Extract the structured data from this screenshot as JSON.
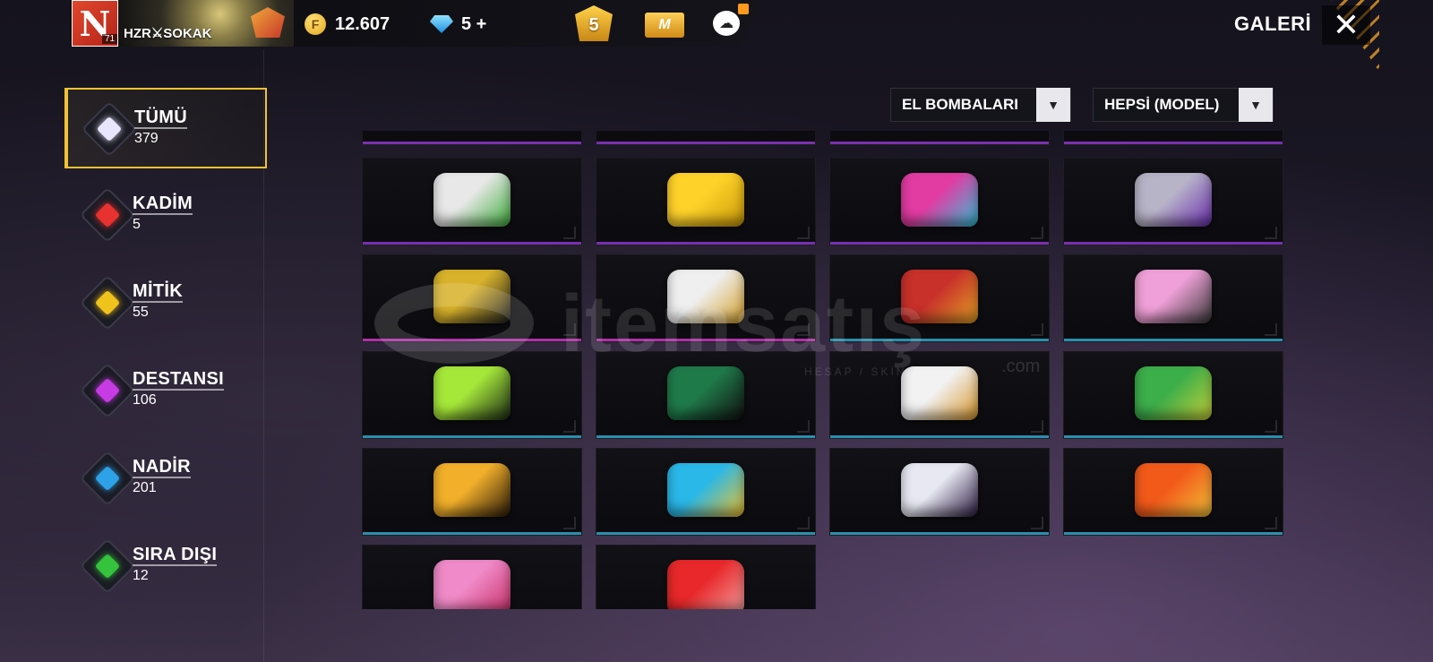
{
  "header": {
    "player_name": "HZR⚔SOKAK",
    "player_level": "71",
    "avatar_letter": "N",
    "coins": "12.607",
    "diamonds": "5 +",
    "pass_level": "5",
    "membership_label": "M",
    "title": "GALERİ"
  },
  "sidebar": {
    "items": [
      {
        "label": "TÜMÜ",
        "count": "379",
        "color": "#e8e6ff"
      },
      {
        "label": "KADİM",
        "count": "5",
        "color": "#e8322f"
      },
      {
        "label": "MİTİK",
        "count": "55",
        "color": "#f0c21c"
      },
      {
        "label": "DESTANSI",
        "count": "106",
        "color": "#c63be4"
      },
      {
        "label": "NADİR",
        "count": "201",
        "color": "#2ea2e8"
      },
      {
        "label": "SIRA DIŞI",
        "count": "12",
        "color": "#35c23c"
      }
    ]
  },
  "filters": {
    "type": "EL BOMBALARI",
    "model": "HEPSİ (MODEL)"
  },
  "watermark": {
    "brand": "itemsatış",
    "tagline": "HESAP / SKİN / ... PİN",
    "domain": ".com"
  },
  "grid_rows": [
    {
      "rarity": "epic",
      "colors": [
        "#7a2fb0",
        "#7a2fb0",
        "#7a2fb0",
        "#7a2fb0"
      ],
      "items": [
        {
          "name": "cat-grenade",
          "c1": "#e8e8e8",
          "c2": "#3fae3c"
        },
        {
          "name": "gold-crystal-grenade",
          "c1": "#ffd22a",
          "c2": "#c99a08"
        },
        {
          "name": "pink-cyan-royal-grenade",
          "c1": "#e23ca3",
          "c2": "#2fc3d8"
        },
        {
          "name": "violet-mecha-grenade",
          "c1": "#b8b4c8",
          "c2": "#6b2fb0"
        }
      ]
    },
    {
      "rarity": "mixed",
      "colors": [
        "#b02fa8",
        "#b02fa8",
        "#2a8fae",
        "#2a8fae"
      ],
      "items": [
        {
          "name": "gold-circuit-grenade",
          "c1": "#d8b22a",
          "c2": "#222"
        },
        {
          "name": "white-gold-wing-grenade",
          "c1": "#efefef",
          "c2": "#d6a12a"
        },
        {
          "name": "red-gold-flame-grenade",
          "c1": "#c8302a",
          "c2": "#e3a326"
        },
        {
          "name": "anime-girl-grenade",
          "c1": "#f0a0d8",
          "c2": "#3a3a3a"
        }
      ]
    },
    {
      "rarity": "rare",
      "colors": [
        "#2a8fae",
        "#2a8fae",
        "#2a8fae",
        "#2a8fae"
      ],
      "items": [
        {
          "name": "neon-green-grenade",
          "c1": "#a6e83a",
          "c2": "#1c2a14"
        },
        {
          "name": "demon-slayer-grenade",
          "c1": "#1f7a4a",
          "c2": "#111"
        },
        {
          "name": "white-phoenix-grenade",
          "c1": "#f2f2f2",
          "c2": "#d8962a"
        },
        {
          "name": "green-dragon-grenade",
          "c1": "#3cae4a",
          "c2": "#c8d23a"
        }
      ]
    },
    {
      "rarity": "rare",
      "colors": [
        "#2a8fae",
        "#2a8fae",
        "#2a8fae",
        "#2a8fae"
      ],
      "items": [
        {
          "name": "pumpkin-grenade",
          "c1": "#f2b02a",
          "c2": "#2a1a0a"
        },
        {
          "name": "truck-grenade",
          "c1": "#2ab8e8",
          "c2": "#f2c22a"
        },
        {
          "name": "dark-white-claw-grenade",
          "c1": "#e8e8f2",
          "c2": "#2a1a40"
        },
        {
          "name": "fire-pig-grenade",
          "c1": "#f25a1a",
          "c2": "#f2c23a"
        }
      ]
    },
    {
      "rarity": "rare",
      "colors": [
        "#2a8fae",
        "#2a8fae"
      ],
      "items": [
        {
          "name": "pink-heart-grenade",
          "c1": "#f08ac8",
          "c2": "#c8326a"
        },
        {
          "name": "red-rune-grenade",
          "c1": "#e8282a",
          "c2": "#f2a0a0"
        }
      ]
    }
  ]
}
